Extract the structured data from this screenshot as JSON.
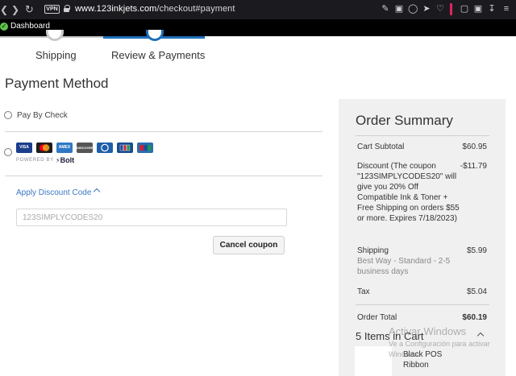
{
  "browser": {
    "vpn_label": "VPN",
    "url_domain": "www.123inkjets.com",
    "url_path": "/checkout#payment",
    "bookmark_label": "Dashboard"
  },
  "steps": [
    {
      "label": "Shipping"
    },
    {
      "label": "Review & Payments"
    }
  ],
  "payment": {
    "title": "Payment Method",
    "pay_by_check": "Pay By Check",
    "cards": [
      {
        "name": "VISA",
        "color": "#1a3e8c"
      },
      {
        "name": "",
        "color": "#1d1d1d"
      },
      {
        "name": "AMEX",
        "color": "#2f78c5"
      },
      {
        "name": "DISCOVER",
        "color": "#555555"
      },
      {
        "name": "",
        "color": "#1f5ea8"
      },
      {
        "name": "",
        "color": "#1a4d8f"
      },
      {
        "name": "",
        "color": "#2a6fb0"
      }
    ],
    "powered_by": "POWERED BY",
    "bolt_label": "Bolt",
    "discount_link": "Apply Discount Code",
    "coupon_value": "123SIMPLYCODES20",
    "cancel_button": "Cancel coupon"
  },
  "summary": {
    "title": "Order Summary",
    "rows": [
      {
        "label": "Cart Subtotal",
        "value": "$60.95"
      },
      {
        "label": "Discount (The coupon \"123SIMPLYCODES20\" will give you 20% Off Compatible Ink & Toner + Free Shipping on orders $55 or more. Expires 7/18/2023)",
        "value": "-$11.79"
      },
      {
        "label": "Shipping",
        "sub": "Best Way - Standard - 2-5 business days",
        "value": "$5.99"
      },
      {
        "label": "Tax",
        "value": "$5.04"
      },
      {
        "label": "Order Total",
        "value": "$60.19"
      }
    ],
    "items_title": "5 Items in Cart",
    "item_name": "Black POS Ribbon"
  },
  "watermark": {
    "title": "Activar Windows",
    "subtitle": "Ve a Configuración para activar Windows."
  }
}
